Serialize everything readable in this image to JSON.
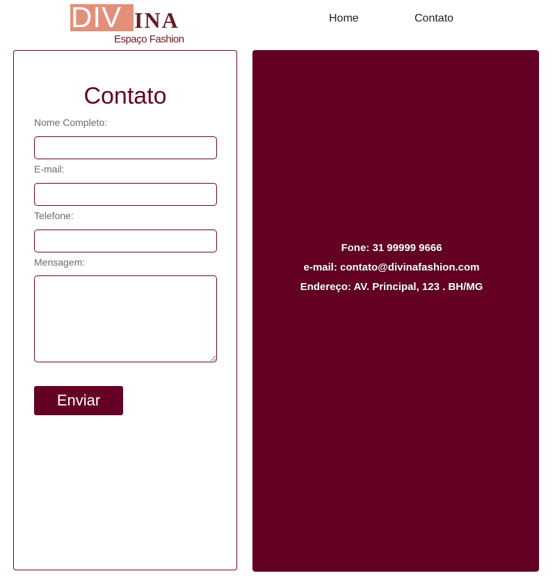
{
  "logo": {
    "brand_main": "DIV",
    "brand_rest": "INA",
    "tagline": "Espaço Fashion"
  },
  "nav": {
    "items": [
      {
        "label": "Home"
      },
      {
        "label": "Contato"
      }
    ]
  },
  "form": {
    "title": "Contato",
    "fields": [
      {
        "label": "Nome Completo:",
        "value": "",
        "placeholder": ""
      },
      {
        "label": "E-mail:",
        "value": "",
        "placeholder": ""
      },
      {
        "label": "Telefone:",
        "value": "",
        "placeholder": ""
      },
      {
        "label": "Mensagem:",
        "value": "",
        "placeholder": ""
      }
    ],
    "submit_label": "Enviar"
  },
  "info": {
    "phone": "Fone: 31 99999 9666",
    "email": "e-mail: contato@divinafashion.com",
    "address": "Endereço: AV. Principal, 123 . BH/MG"
  },
  "colors": {
    "brand_wine": "#650025",
    "logo_salmon": "#e2907a",
    "logo_dark": "#6a1a22"
  }
}
